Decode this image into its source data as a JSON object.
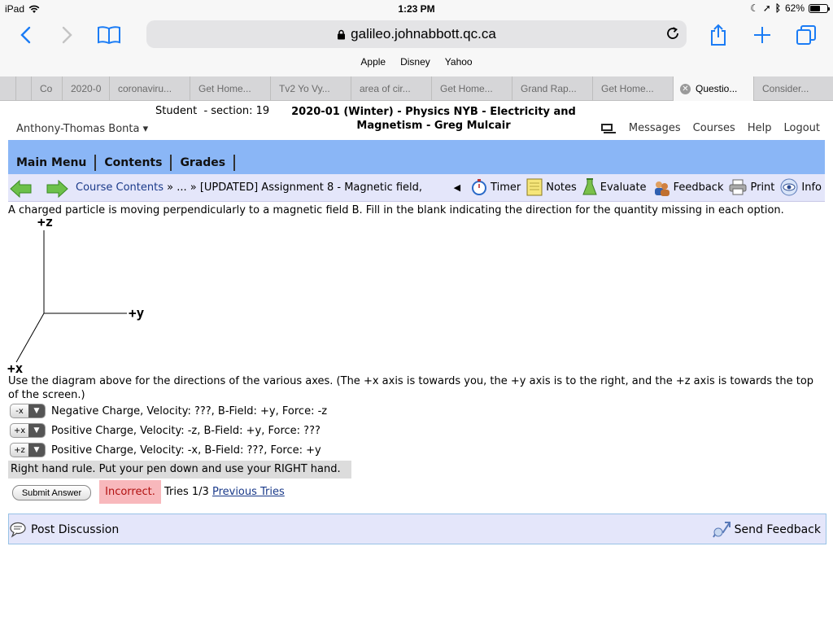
{
  "status_bar": {
    "device": "iPad",
    "time": "1:23 PM",
    "battery": "62%",
    "battery_level": 0.62
  },
  "browser": {
    "url": "galileo.johnabbott.qc.ca",
    "favorites": [
      "Apple",
      "Disney",
      "Yahoo"
    ],
    "tabs": [
      "Co",
      "2020-0",
      "coronaviru...",
      "Get Home...",
      "Tv2 Yo Vy...",
      "area of cir...",
      "Get Home...",
      "Grand Rap...",
      "Get Home...",
      "Questio...",
      "Consider..."
    ],
    "active_tab_index": 9
  },
  "header": {
    "student": "Student  - section: 19",
    "course_line1": "2020-01 (Winter) - Physics NYB - Electricity and",
    "course_line2": "Magnetism - Greg Mulcair",
    "user": "Anthony-Thomas Bonta ▾",
    "links": {
      "messages": "Messages",
      "courses": "Courses",
      "help": "Help",
      "logout": "Logout"
    }
  },
  "menu": [
    "Main Menu",
    "Contents",
    "Grades"
  ],
  "nav": {
    "course_contents": "Course Contents",
    "breadcrumb_rest": " » ... » [UPDATED] Assignment 8 - Magnetic field,",
    "tools": {
      "timer": "Timer",
      "notes": "Notes",
      "evaluate": "Evaluate",
      "feedback": "Feedback",
      "print": "Print",
      "info": "Info"
    }
  },
  "problem": {
    "question": "A charged particle is moving perpendicularly to a magnetic field B. Fill in the blank indicating the direction for the quantity missing in each option.",
    "axes": {
      "z": "+z",
      "y": "+y",
      "x": "+x"
    },
    "instructions": "Use the diagram above for the directions of the various axes. (The +x axis is towards you, the +y axis is to the right, and the +z axis is towards the top of the screen.)",
    "options": [
      {
        "selected": "-x",
        "text": "Negative Charge, Velocity: ???, B-Field: +y, Force: -z"
      },
      {
        "selected": "+x",
        "text": "Positive Charge, Velocity: -z, B-Field: +y, Force: ???"
      },
      {
        "selected": "+z",
        "text": "Positive Charge, Velocity: -x, B-Field: ???, Force: +y"
      }
    ],
    "hint": "Right hand rule. Put your pen down and use your RIGHT hand.",
    "submit_label": "Submit Answer",
    "result": "Incorrect.",
    "tries": "Tries 1/3",
    "previous_tries": "Previous Tries"
  },
  "footer": {
    "post_discussion": "Post Discussion",
    "send_feedback": "Send Feedback"
  }
}
